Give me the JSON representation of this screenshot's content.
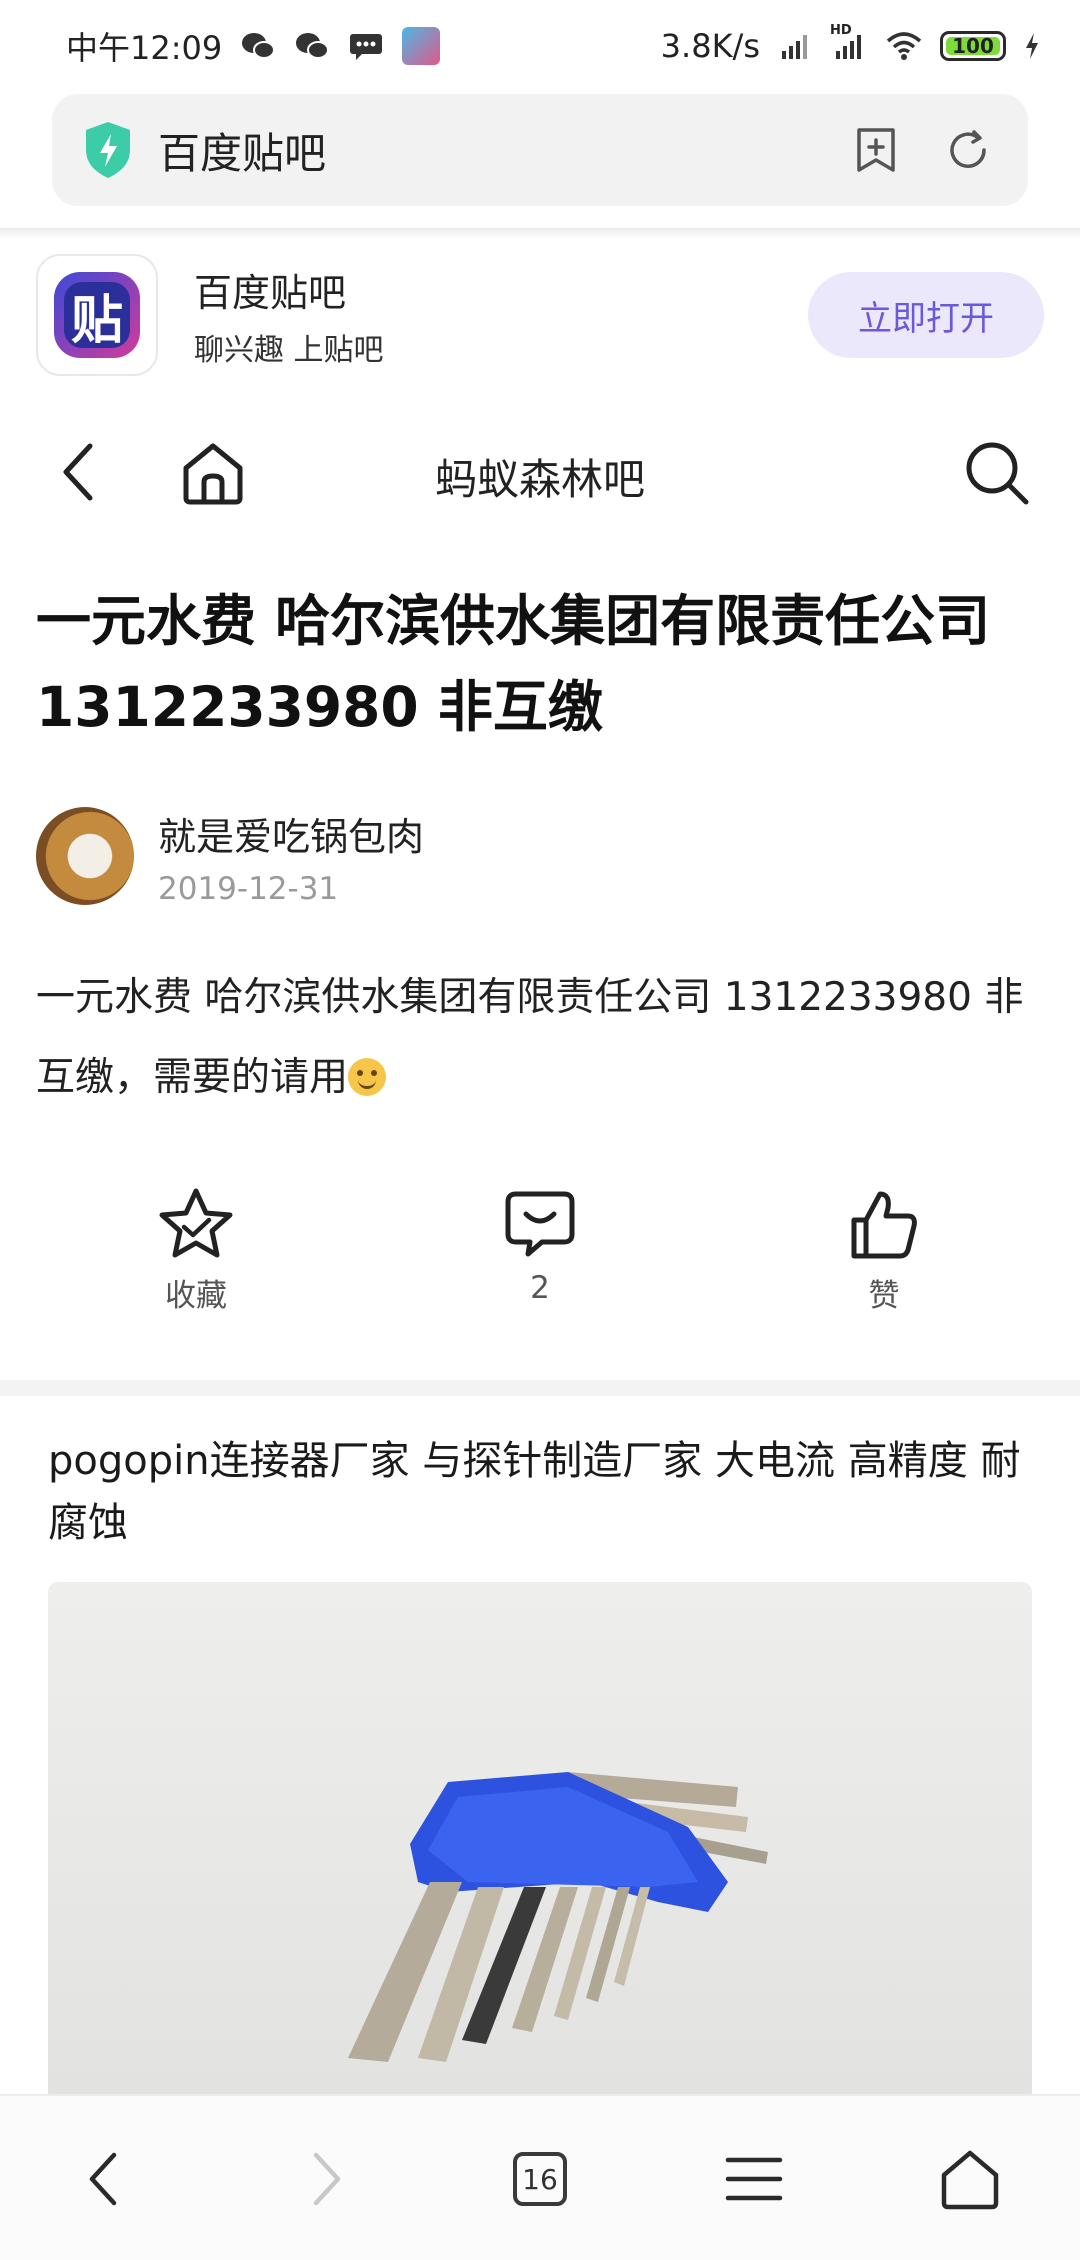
{
  "status_bar": {
    "time": "中午12:09",
    "net_speed": "3.8K/s",
    "hd_label": "HD",
    "battery": "100"
  },
  "address_bar": {
    "text": "百度贴吧"
  },
  "app_banner": {
    "logo_char": "贴",
    "name": "百度贴吧",
    "slogan": "聊兴趣 上贴吧",
    "open_label": "立即打开"
  },
  "nav": {
    "title": "蚂蚁森林吧"
  },
  "post": {
    "title": "一元水费 哈尔滨供水集团有限责任公司 1312233980 非互缴",
    "author": "就是爱吃锅包肉",
    "date": "2019-12-31",
    "body": "一元水费 哈尔滨供水集团有限责任公司 1312233980 非互缴，需要的请用"
  },
  "actions": {
    "favorite_label": "收藏",
    "comment_count": "2",
    "like_label": "赞"
  },
  "ad": {
    "title": "pogopin连接器厂家 与探针制造厂家 大电流 高精度 耐腐蚀"
  },
  "bottom_bar": {
    "tab_count": "16"
  },
  "colors": {
    "accent": "#6a5ad9",
    "open_bg": "#ebe8fb",
    "shield": "#3ccca8"
  }
}
